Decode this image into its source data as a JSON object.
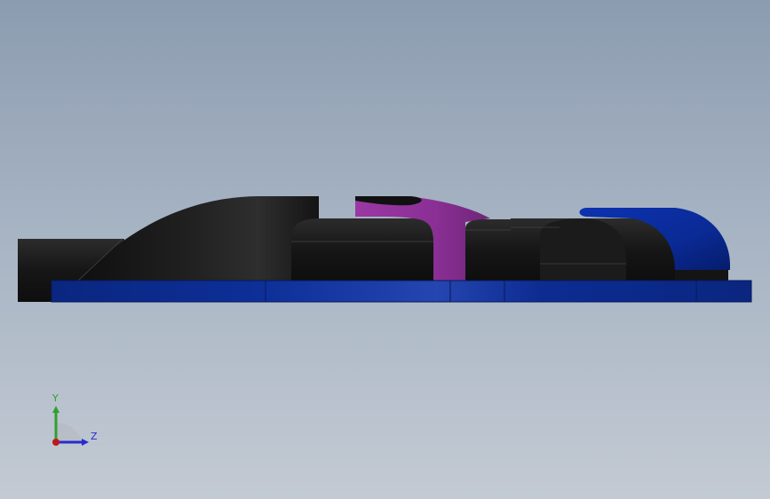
{
  "view": {
    "background_top": "#8c9cb0",
    "background_bottom": "#c3cad3"
  },
  "model": {
    "colors": {
      "black_body": "#121212",
      "black_highlight": "#3a3a3a",
      "blue_base": "#0b2a8c",
      "blue_highlight": "#2747b5",
      "blue_cap": "#0a2da0",
      "purple_part": "#8a2f94"
    }
  },
  "triad": {
    "y_label": "Y",
    "z_label": "Z",
    "y_color": "#2fa02f",
    "z_color": "#2a2ad0",
    "origin_color": "#c01818"
  }
}
